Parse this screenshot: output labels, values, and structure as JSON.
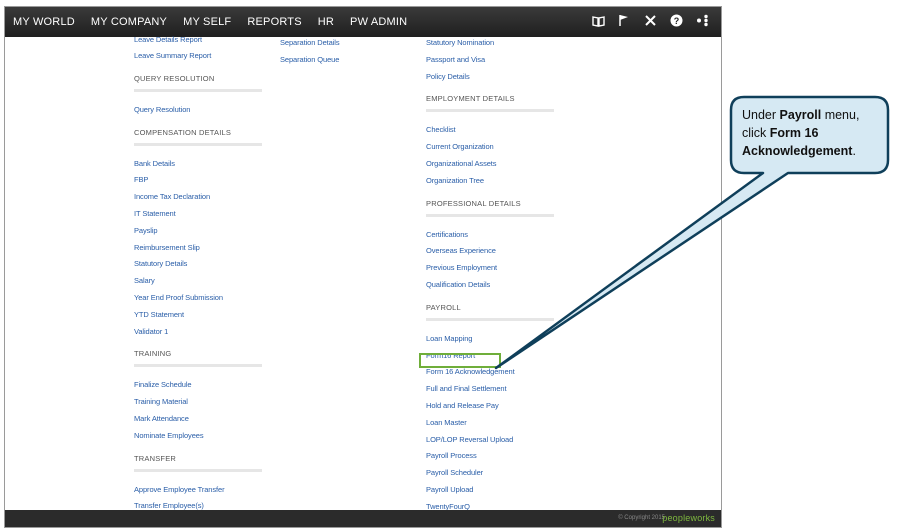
{
  "topnav": {
    "items": [
      "MY WORLD",
      "MY COMPANY",
      "MY SELF",
      "REPORTS",
      "HR",
      "PW ADMIN"
    ],
    "icons": [
      "book-icon",
      "flag-icon",
      "tools-icon",
      "help-icon",
      "share-icon"
    ]
  },
  "menu": {
    "col1": {
      "top_link": "Leave Details Report",
      "link_leave_summary": "Leave Summary Report",
      "sec_query": "QUERY RESOLUTION",
      "link_query": "Query Resolution",
      "sec_comp": "COMPENSATION DETAILS",
      "comp_links": [
        "Bank Details",
        "FBP",
        "Income Tax Declaration",
        "IT Statement",
        "Payslip",
        "Reimbursement Slip",
        "Statutory Details",
        "Salary",
        "Year End Proof Submission",
        "YTD Statement",
        "Validator 1"
      ],
      "sec_training": "TRAINING",
      "training_links": [
        "Finalize Schedule",
        "Training Material",
        "Mark Attendance",
        "Nominate Employees"
      ],
      "sec_transfer": "TRANSFER",
      "transfer_links": [
        "Approve Employee Transfer",
        "Transfer Employee(s)"
      ]
    },
    "col2": {
      "links": [
        "Separation Details",
        "Separation Queue"
      ]
    },
    "col3": {
      "top_link": "Statutory Nomination",
      "links_top": [
        "Passport and Visa",
        "Policy Details"
      ],
      "sec_employment": "EMPLOYMENT DETAILS",
      "employment_links": [
        "Checklist",
        "Current Organization",
        "Organizational Assets",
        "Organization Tree"
      ],
      "sec_professional": "PROFESSIONAL DETAILS",
      "professional_links": [
        "Certifications",
        "Overseas Experience",
        "Previous Employment",
        "Qualification Details"
      ],
      "sec_payroll": "PAYROLL",
      "payroll_links": [
        "Loan Mapping",
        "Form16 Report",
        "Form 16 Acknowledgement",
        "Full and Final Settlement",
        "Hold and Release Pay",
        "Loan Master",
        "LOP/LOP Reversal Upload",
        "Payroll Process",
        "Payroll Scheduler",
        "Payroll Upload",
        "TwentyFourQ"
      ]
    }
  },
  "footer": {
    "copyright": "© Copyright 2015",
    "brand": "peopleworks"
  },
  "callout": {
    "line1_a": "Under ",
    "line1_b": "Payroll",
    "line1_c": " menu,",
    "line2_a": "click ",
    "line2_b": "Form 16",
    "line3_b": "Acknowledgement",
    "line3_c": "."
  },
  "colors": {
    "link": "#2a5ea8",
    "topbar": "#2b2b2b",
    "callout_fill": "#d6e9f3",
    "callout_border": "#0f3f5a",
    "highlight": "#6fae3a"
  }
}
